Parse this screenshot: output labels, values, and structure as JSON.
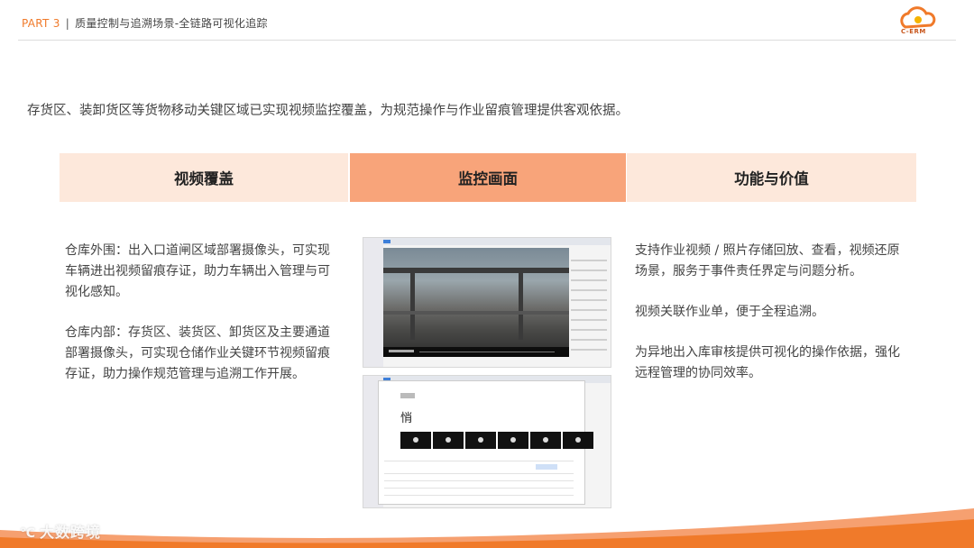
{
  "header": {
    "part": "PART 3",
    "separator": "|",
    "title": "质量控制与追溯场景-全链路可视化追踪",
    "logo_text": "C-ERM"
  },
  "intro": "存货区、装卸货区等货物移动关键区域已实现视频监控覆盖，为规范操作与作业留痕管理提供客观依据。",
  "columns": {
    "video_coverage": "视频覆盖",
    "monitor_view": "监控画面",
    "function_value": "功能与价值"
  },
  "left_paragraphs": [
    "仓库外围：出入口道闸区域部署摄像头，可实现车辆进出视频留痕存证，助力车辆出入管理与可视化感知。",
    "仓库内部：存货区、装货区、卸货区及主要通道部署摄像头，可实现仓储作业关键环节视频留痕存证，助力操作规范管理与追溯工作开展。"
  ],
  "right_paragraphs": [
    "支持作业视频 / 照片存储回放、查看，视频还原场景，服务于事件责任界定与问题分析。",
    "视频关联作业单，便于全程追溯。",
    "为异地出入库审核提供可视化的操作依据，强化远程管理的协同效率。"
  ],
  "footer": {
    "brand": "大数跨境",
    "mark": "℃"
  },
  "colors": {
    "accent": "#f07a2a",
    "header_light": "#fde8db",
    "header_active": "#f8a47a"
  }
}
